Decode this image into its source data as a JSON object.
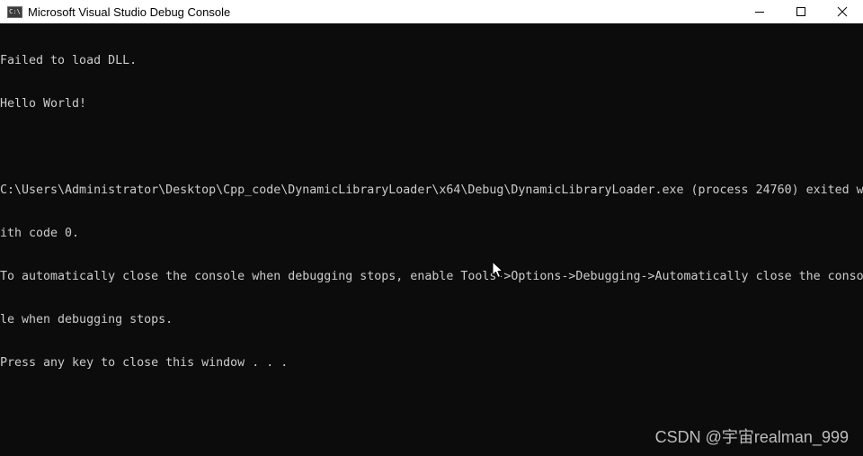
{
  "window": {
    "title": "Microsoft Visual Studio Debug Console",
    "icon": "C:\\",
    "controls": [
      "minimize-icon",
      "maximize-icon",
      "close-icon"
    ]
  },
  "console": {
    "lines": [
      "Failed to load DLL.",
      "Hello World!",
      "",
      "C:\\Users\\Administrator\\Desktop\\Cpp_code\\DynamicLibraryLoader\\x64\\Debug\\DynamicLibraryLoader.exe (process 24760) exited w",
      "ith code 0.",
      "To automatically close the console when debugging stops, enable Tools->Options->Debugging->Automatically close the conso",
      "le when debugging stops.",
      "Press any key to close this window . . ."
    ]
  },
  "watermark": "CSDN @宇宙realman_999",
  "colors": {
    "background": "#0c0c0c",
    "text": "#cccccc",
    "titlebar": "#ffffff"
  }
}
